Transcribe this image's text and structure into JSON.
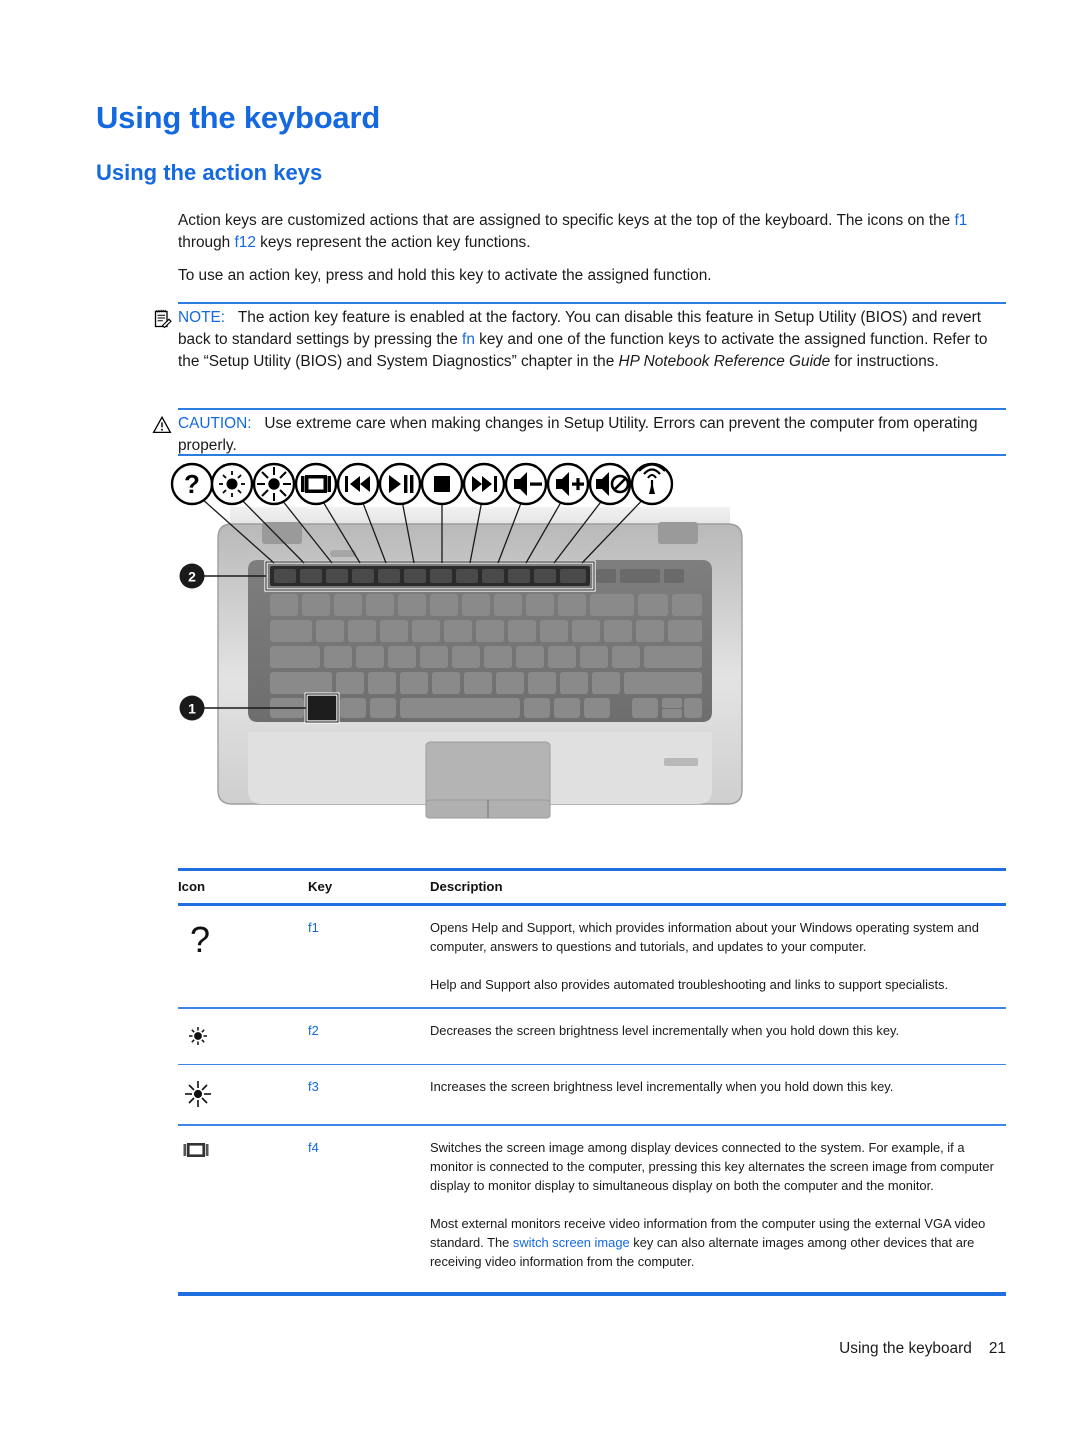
{
  "document": {
    "heading": "Using the keyboard",
    "subheading": "Using the action keys",
    "paragraphs": {
      "p1_a": "Action keys are customized actions that are assigned to specific keys at the top of the keyboard. The icons on the ",
      "p1_link1": "f1",
      "p1_b": " through ",
      "p1_link2": "f12",
      "p1_c": " keys represent the action key functions.",
      "p2": "To use an action key, press and hold this key to activate the assigned function."
    },
    "note": {
      "label": "NOTE:",
      "icon": "note-pad-icon",
      "text_a": "The action key feature is enabled at the factory. You can disable this feature in Setup Utility (BIOS) and revert back to standard settings by pressing the ",
      "link": "fn",
      "text_b": " key and one of the function keys to activate the assigned function. Refer to the “Setup Utility (BIOS) and System Diagnostics” chapter in the ",
      "italic": "HP Notebook Reference Guide",
      "text_c": " for instructions."
    },
    "caution": {
      "label": "CAUTION:",
      "icon": "warning-triangle-icon",
      "text": "Use extreme care when making changes in Setup Utility. Errors can prevent the computer from operating properly."
    },
    "illustration": {
      "callouts": [
        {
          "number": "1",
          "target": "fn-key"
        },
        {
          "number": "2",
          "target": "action-key-row"
        }
      ],
      "action_icons": [
        {
          "name": "help-icon",
          "glyph": "?"
        },
        {
          "name": "brightness-down-icon",
          "glyph": "sun-small"
        },
        {
          "name": "brightness-up-icon",
          "glyph": "sun-large"
        },
        {
          "name": "switch-screen-image-icon",
          "glyph": "monitor"
        },
        {
          "name": "previous-track-icon",
          "glyph": "prev"
        },
        {
          "name": "play-pause-icon",
          "glyph": "play-pause"
        },
        {
          "name": "stop-icon",
          "glyph": "stop"
        },
        {
          "name": "next-track-icon",
          "glyph": "next"
        },
        {
          "name": "volume-down-icon",
          "glyph": "speaker-minus"
        },
        {
          "name": "volume-up-icon",
          "glyph": "speaker-plus"
        },
        {
          "name": "mute-icon",
          "glyph": "speaker-mute"
        },
        {
          "name": "wireless-icon",
          "glyph": "antenna"
        }
      ]
    },
    "table": {
      "headers": {
        "icon": "Icon",
        "key": "Key",
        "description": "Description"
      },
      "rows": [
        {
          "icon": "help-question-mark-icon",
          "key": "f1",
          "paragraphs": [
            "Opens Help and Support, which provides information about your Windows operating system and computer, answers to questions and tutorials, and updates to your computer.",
            "Help and Support also provides automated troubleshooting and links to support specialists."
          ]
        },
        {
          "icon": "brightness-down-icon",
          "key": "f2",
          "paragraphs": [
            "Decreases the screen brightness level incrementally when you hold down this key."
          ]
        },
        {
          "icon": "brightness-up-icon",
          "key": "f3",
          "paragraphs": [
            "Increases the screen brightness level incrementally when you hold down this key."
          ]
        },
        {
          "icon": "switch-screen-image-icon",
          "key": "f4",
          "paragraphs": [
            "Switches the screen image among display devices connected to the system. For example, if a monitor is connected to the computer, pressing this key alternates the screen image from computer display to monitor display to simultaneous display on both the computer and the monitor."
          ],
          "para2_a": "Most external monitors receive video information from the computer using the external VGA video standard. The ",
          "para2_link": "switch screen image",
          "para2_b": " key can also alternate images among other devices that are receiving video information from the computer."
        }
      ]
    },
    "footer": {
      "chapter": "Using the keyboard",
      "page_number": "21",
      "combined": "Using the keyboard    21"
    },
    "colors": {
      "heading_blue": "#1569e0",
      "link_blue": "#1569e0",
      "rule_blue": "#1f6fe0",
      "text_black": "#1a1a1a"
    }
  }
}
